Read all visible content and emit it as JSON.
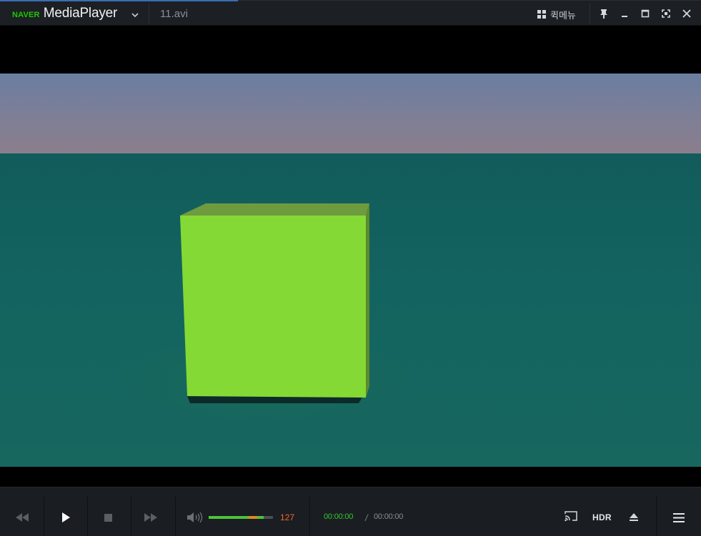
{
  "titlebar": {
    "brand_prefix": "NAVER",
    "brand_name": "MediaPlayer",
    "filename": "11.avi",
    "quickmenu_label": "퀵메뉴",
    "icons": [
      "chevron-down-icon",
      "grid-icon",
      "pin-icon",
      "minimize-icon",
      "maximize-icon",
      "fullscreen-icon",
      "close-icon"
    ]
  },
  "controls": {
    "volume_value": "127",
    "volume_level_percent": 100,
    "volume_boost_percent": 27,
    "time_current": "00:00:00",
    "time_separator": "/",
    "time_total": "00:00:00",
    "hdr_label": "HDR",
    "icons": [
      "rewind-icon",
      "play-icon",
      "stop-icon",
      "fast-forward-icon",
      "speaker-icon",
      "cast-icon",
      "eject-icon",
      "menu-icon"
    ]
  },
  "colors": {
    "brand_green": "#1ec800",
    "volume_fill": "#4cc43a",
    "volume_boost": "#e0891e",
    "volume_value": "#f06a2a",
    "time_current": "#32c832",
    "cube_face": "#84d934"
  }
}
